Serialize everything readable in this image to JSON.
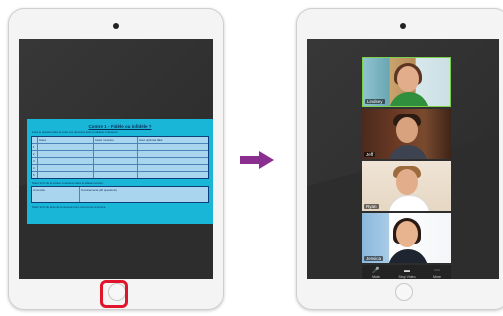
{
  "document": {
    "title": "Contre 1 - Fidèle ou infidèle ?",
    "subtitle": "Lisez le questionnaire et notez vos réponses dans le tableau ci-dessous.",
    "columns": [
      "",
      "Actes",
      "Avant / Aucune",
      "Avec optimisé fâké"
    ],
    "rows": [
      "1",
      "2",
      "3",
      "4",
      "5"
    ],
    "note": "Notez la fin de la phrase ci-dessous dans le tableau suivant.",
    "section_left": "Limoncito",
    "section_right": "Tecnicamente (20 questions)",
    "footer": "Notez la fin du texte de la réponse pour commencer la lecture."
  },
  "participants": [
    {
      "name": "Lindsey"
    },
    {
      "name": "Jeff"
    },
    {
      "name": "Ryan"
    },
    {
      "name": "Jessica"
    }
  ],
  "controls": [
    {
      "label": "Mute",
      "icon": "microphone-icon"
    },
    {
      "label": "Stop Video",
      "icon": "video-camera-icon"
    },
    {
      "label": "More",
      "icon": "more-icon"
    }
  ],
  "colors": {
    "arrow": "#8a2f8f",
    "highlight": "#e0142a",
    "document_bg": "#19b6d8",
    "active_speaker": "#7bd24a"
  }
}
